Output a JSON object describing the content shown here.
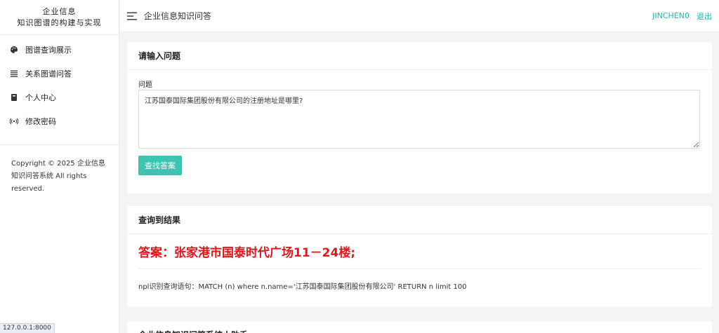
{
  "sidebar": {
    "brand_line1": "企业信息",
    "brand_line2": "知识图谱的构建与实现",
    "items": [
      {
        "label": "图谱查询展示",
        "icon": "palette-icon"
      },
      {
        "label": "关系图谱问答",
        "icon": "list-icon"
      },
      {
        "label": "个人中心",
        "icon": "book-icon"
      },
      {
        "label": "修改密码",
        "icon": "broadcast-icon"
      }
    ],
    "copyright": "Copyright © 2025 企业信息知识问答系统 All rights reserved."
  },
  "topbar": {
    "title": "企业信息知识问答",
    "username": "JINCHEN0",
    "logout": "退出"
  },
  "question_card": {
    "header": "请输入问题",
    "field_label": "问题",
    "question_value": "江苏国泰国际集团股份有限公司的注册地址是哪里?",
    "button_label": "查找答案"
  },
  "result_card": {
    "header": "查询到结果",
    "answer": "答案：张家港市国泰时代广场11－24楼;",
    "cypher": "npl识别查询语句：MATCH (n) where n.name='江苏国泰国际集团股份有限公司' RETURN n limit 100"
  },
  "assistant_card": {
    "header": "企业信息知识问答系统小助手"
  },
  "status_url": "127.0.0.1:8000",
  "colors": {
    "accent": "#3cc4b1",
    "link": "#26b5a8",
    "answer": "#e5151a"
  }
}
